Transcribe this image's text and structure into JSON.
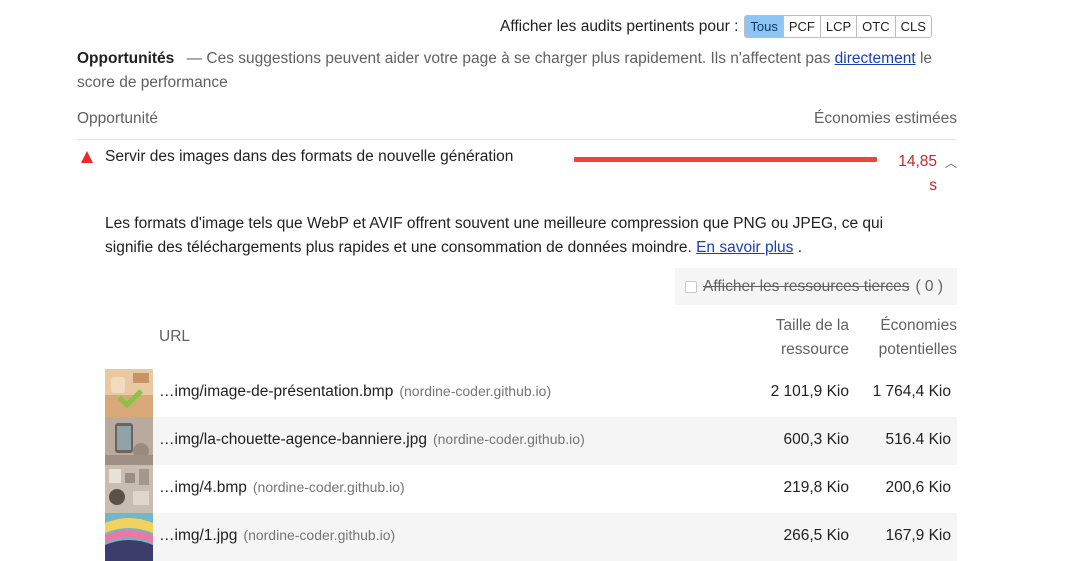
{
  "filter": {
    "label": "Afficher les audits pertinents pour :",
    "buttons": [
      "Tous",
      "PCF",
      "LCP",
      "OTC",
      "CLS"
    ],
    "active": "Tous"
  },
  "opportunities": {
    "title": "Opportunités",
    "description_before": "— Ces suggestions peuvent aider votre page à se charger plus rapidement. Ils n'affectent pas ",
    "link": "directement",
    "description_after": " le score de performance"
  },
  "columns": {
    "opportunity": "Opportunité",
    "savings": "Économies estimées"
  },
  "audit": {
    "title": "Servir des images dans des formats de nouvelle génération",
    "savings": "14,85 s",
    "savings_fraction": 1.0,
    "description": "Les formats d'image tels que WebP et AVIF offrent souvent une meilleure compression que PNG ou JPEG, ce qui signifie des téléchargements plus rapides et une consommation de données moindre. ",
    "learn_more": "En savoir plus",
    "period": " ."
  },
  "third_party": {
    "label": "Afficher les ressources tierces",
    "count": "( 0 )"
  },
  "table": {
    "headers": {
      "url": "URL",
      "size": "Taille de la ressource",
      "savings": "Économies potentielles"
    },
    "rows": [
      {
        "url": "…img/image-de-présentation.bmp",
        "host": "(nordine-coder.github.io)",
        "size": "2 101,9 Kio",
        "savings": "1 764,4 Kio"
      },
      {
        "url": "…img/la-chouette-agence-banniere.jpg",
        "host": "(nordine-coder.github.io)",
        "size": "600,3 Kio",
        "savings": "516.4 Kio"
      },
      {
        "url": "…img/4.bmp",
        "host": "(nordine-coder.github.io)",
        "size": "219,8 Kio",
        "savings": "200,6 Kio"
      },
      {
        "url": "…img/1.jpg",
        "host": "(nordine-coder.github.io)",
        "size": "266,5 Kio",
        "savings": "167,9 Kio"
      }
    ]
  },
  "colors": {
    "accent_active": "#8ec5f5",
    "fail_red": "#f44336",
    "link": "#1a3fb5"
  }
}
